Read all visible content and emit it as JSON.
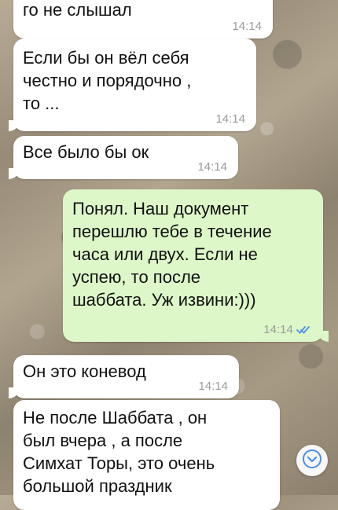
{
  "messages": [
    {
      "text": "го не слышал",
      "time": "14:14"
    },
    {
      "text": "Если бы он вёл себя\nчестно и порядочно ,\nто ...",
      "time": "14:14"
    },
    {
      "text": "Все было бы ок",
      "time": "14:14"
    },
    {
      "text": "Понял. Наш документ\nперешлю тебе в течение\nчаса или двух. Если не\nуспею, то после\nшаббата. Уж извини:)))",
      "time": "14:14",
      "status": "read"
    },
    {
      "text": "Он это коневод",
      "time": "14:14"
    },
    {
      "text": "Не после Шаббата , он\nбыл вчера , а после\nСимхат Торы, это очень\nбольшой праздник"
    }
  ],
  "accent_color": "#4a8fe7"
}
